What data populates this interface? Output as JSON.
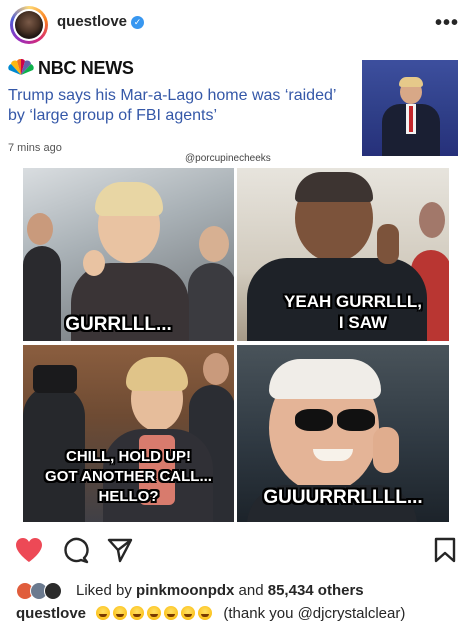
{
  "header": {
    "username": "questlove",
    "more_label": "•••"
  },
  "post": {
    "source_name": "NBC NEWS",
    "headline": "Trump says his Mar-a-Lago home was ‘raided’ by ‘large group of FBI agents’",
    "timestamp": "7 mins ago",
    "credit": "@porcupinecheeks",
    "captions": {
      "panel1": "GURRLLL...",
      "panel2_line1": "YEAH GURRLLL,",
      "panel2_line2": "I SAW",
      "panel3_line1": "CHILL, HOLD UP!",
      "panel3_line2": "GOT ANOTHER CALL...",
      "panel3_line3": "HELLO?",
      "panel4": "GUUURRRLLLL..."
    }
  },
  "engagement": {
    "liked_prefix": "Liked by",
    "liked_user": "pinkmoonpdx",
    "liked_connector": "and",
    "liked_count": "85,434 others"
  },
  "caption": {
    "username": "questlove",
    "text": "(thank you @djcrystalclear)"
  },
  "colors": {
    "heart": "#ed4956",
    "verified": "#3897f0",
    "headline": "#3558a8"
  }
}
